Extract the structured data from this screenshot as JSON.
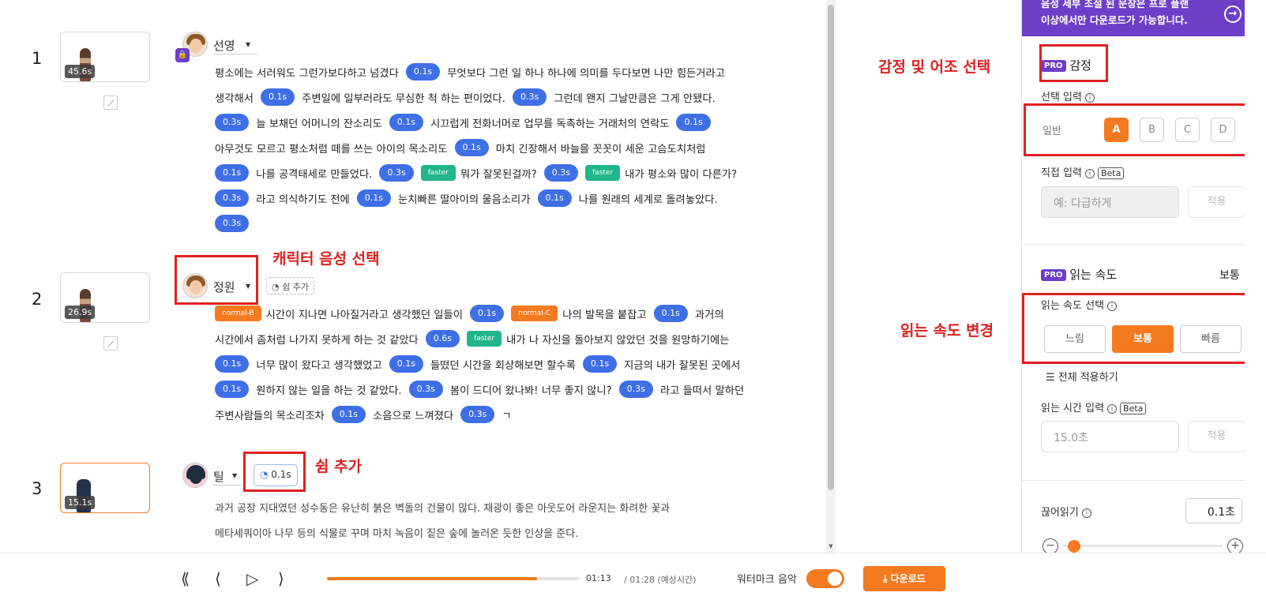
{
  "annotations": {
    "emotion": "감정 및 어조 선택",
    "voice": "캐릭터 음성 선택",
    "speed": "읽는 속도 변경",
    "rest": "쉼 추가"
  },
  "blocks": [
    {
      "index": "1",
      "duration": "45.6s",
      "speaker": "선영",
      "lines": [
        [
          {
            "k": "t",
            "v": "평소에는 서러워도 그런가보다하고 넘겼다"
          },
          {
            "k": "p",
            "v": "0.1s"
          },
          {
            "k": "t",
            "v": "무엇보다 그런 일 하나 하나에 의미를 두다보면 나만 힘든거라고"
          }
        ],
        [
          {
            "k": "t",
            "v": "생각해서"
          },
          {
            "k": "p",
            "v": "0.1s"
          },
          {
            "k": "t",
            "v": "주변일에 일부러라도 무심한 척 하는 편이었다."
          },
          {
            "k": "p",
            "v": "0.3s"
          },
          {
            "k": "t",
            "v": "그런데 왠지 그날만큼은 그게 안됐다."
          }
        ],
        [
          {
            "k": "p",
            "v": "0.3s"
          },
          {
            "k": "t",
            "v": "늘 보채던 어머니의 잔소리도"
          },
          {
            "k": "p",
            "v": "0.1s"
          },
          {
            "k": "t",
            "v": "시끄럽게 전화너머로 업무를 독촉하는 거래처의 연락도"
          },
          {
            "k": "p",
            "v": "0.1s"
          }
        ],
        [
          {
            "k": "t",
            "v": "아무것도 모르고 평소처럼 떼를 쓰는 아이의 목소리도"
          },
          {
            "k": "p",
            "v": "0.1s"
          },
          {
            "k": "t",
            "v": "마치 긴장해서 바늘을 꼿꼿이 세운 고슴도치처럼"
          }
        ],
        [
          {
            "k": "p",
            "v": "0.1s"
          },
          {
            "k": "t",
            "v": "나를 공격태세로 만들었다."
          },
          {
            "k": "p",
            "v": "0.3s"
          },
          {
            "k": "g",
            "v": "faster"
          },
          {
            "k": "t",
            "v": "뭐가 잘못된걸까?"
          },
          {
            "k": "p",
            "v": "0.3s"
          },
          {
            "k": "g",
            "v": "faster"
          },
          {
            "k": "t",
            "v": "내가 평소와 많이 다른가?"
          }
        ],
        [
          {
            "k": "p",
            "v": "0.3s"
          },
          {
            "k": "t",
            "v": "라고 의식하기도 전에"
          },
          {
            "k": "p",
            "v": "0.1s"
          },
          {
            "k": "t",
            "v": "눈치빠른 딸아이의 울음소리가"
          },
          {
            "k": "p",
            "v": "0.1s"
          },
          {
            "k": "t",
            "v": "나를 원래의 세계로 돌려놓았다."
          }
        ],
        [
          {
            "k": "p",
            "v": "0.3s"
          }
        ]
      ]
    },
    {
      "index": "2",
      "duration": "26.9s",
      "speaker": "정원",
      "rest_label": "쉼 추가",
      "lines": [
        [
          {
            "k": "o",
            "v": "normal-B"
          },
          {
            "k": "t",
            "v": "시간이 지나면 나아질거라고 생각했던 일들이"
          },
          {
            "k": "p",
            "v": "0.1s"
          },
          {
            "k": "o",
            "v": "normal-C"
          },
          {
            "k": "t",
            "v": "나의 발목을 붙잡고"
          },
          {
            "k": "p",
            "v": "0.1s"
          },
          {
            "k": "t",
            "v": "과거의"
          }
        ],
        [
          {
            "k": "t",
            "v": "시간에서 좀처럼 나가지 못하게 하는 것 같았다"
          },
          {
            "k": "p",
            "v": "0.6s"
          },
          {
            "k": "g",
            "v": "faster"
          },
          {
            "k": "t",
            "v": "내가 나 자신을 돌아보지 않았던 것을 원망하기에는"
          }
        ],
        [
          {
            "k": "p",
            "v": "0.1s"
          },
          {
            "k": "t",
            "v": "너무 많이 왔다고 생각했었고"
          },
          {
            "k": "p",
            "v": "0.1s"
          },
          {
            "k": "t",
            "v": "들떴던 시간을 회상해보면 할수록"
          },
          {
            "k": "p",
            "v": "0.1s"
          },
          {
            "k": "t",
            "v": "지금의 내가 잘못된 곳에서"
          }
        ],
        [
          {
            "k": "p",
            "v": "0.1s"
          },
          {
            "k": "t",
            "v": "원하지 않는 일을 하는 것 같았다."
          },
          {
            "k": "p",
            "v": "0.3s"
          },
          {
            "k": "t",
            "v": "봄이 드디어 왔나봐! 너무 좋지 않니?"
          },
          {
            "k": "p",
            "v": "0.3s"
          },
          {
            "k": "t",
            "v": "라고 들떠서 말하던"
          }
        ],
        [
          {
            "k": "t",
            "v": "주변사람들의 목소리조차"
          },
          {
            "k": "p",
            "v": "0.1s"
          },
          {
            "k": "t",
            "v": "소음으로 느껴졌다"
          },
          {
            "k": "p",
            "v": "0.3s"
          },
          {
            "k": "t",
            "v": "ㄱ"
          }
        ]
      ]
    },
    {
      "index": "3",
      "duration": "15.1s",
      "speaker": "틸",
      "rest_value": "0.1s",
      "text_lines": [
        "과거 공장 지대였던 성수동은 유난히 붉은 벽돌의 건물이 많다. 채광이 좋은 아웃도어 라운지는 화려한 꽃과",
        "메타세쿼이아 나무 등의 식물로 꾸며 마치 녹음이 짙은 숲에 놀러온 듯한 인상을 준다."
      ]
    }
  ],
  "panel": {
    "banner_line1": "음성 세부 조절 된 문장은 프로 플랜",
    "banner_line2": "이상에서만 다운로드가 가능합니다.",
    "pro_badge": "PRO",
    "emotion_title": "감정",
    "select_input_label": "선택 입력",
    "emotion_name": "일반",
    "emotion_options": [
      "A",
      "B",
      "C",
      "D"
    ],
    "direct_input_label": "직접 입력",
    "beta": "Beta",
    "direct_placeholder": "예: 다급하게",
    "apply": "적용",
    "speed_title": "읽는 속도",
    "speed_value": "보통",
    "speed_select_label": "읽는 속도 선택",
    "speed_options": [
      "느림",
      "보통",
      "빠름"
    ],
    "apply_all": "전체 적용하기",
    "read_time_label": "읽는 시간 입력",
    "read_time_placeholder": "15.0초",
    "pause_label": "끊어읽기",
    "pause_value": "0.1초",
    "pause_level": 0.03
  },
  "player": {
    "current_time": "01:13",
    "total_time": "/ 01:28 (예상시간)",
    "progress": 0.83,
    "watermark_label": "워터마크 음악",
    "watermark_on": true,
    "download_label": "다운로드"
  },
  "colors": {
    "accent": "#f47a20",
    "pause_chip": "#3f6fe6",
    "speed_chip": "#20b58a",
    "pro": "#6c3fc7",
    "annotation": "#e02020"
  }
}
